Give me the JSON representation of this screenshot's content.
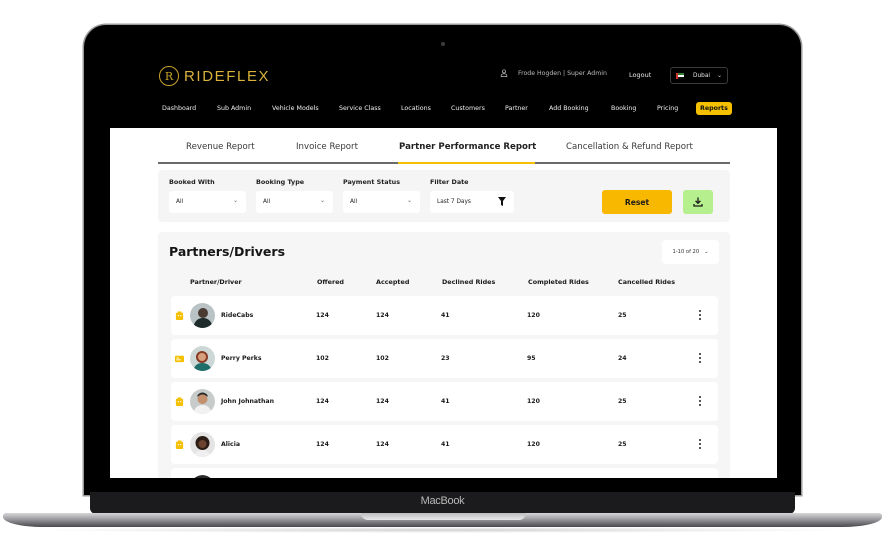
{
  "device": {
    "chin_label": "MacBook"
  },
  "header": {
    "brand": "RIDEFLEX",
    "logo_glyph": "R",
    "user_name": "Frode Hogden",
    "user_role": "| Super Admin",
    "logout_label": "Logout",
    "city": "Dubai",
    "city_flag": "uae-flag",
    "accent_color": "#f5c000"
  },
  "nav": {
    "items": [
      {
        "label": "Dashboard"
      },
      {
        "label": "Sub Admin"
      },
      {
        "label": "Vehicle Models"
      },
      {
        "label": "Service Class"
      },
      {
        "label": "Locations"
      },
      {
        "label": "Customers"
      },
      {
        "label": "Partner"
      },
      {
        "label": "Add Booking"
      },
      {
        "label": "Booking"
      },
      {
        "label": "Pricing"
      },
      {
        "label": "Reports",
        "active": true
      }
    ]
  },
  "tabs": [
    {
      "label": "Revenue Report"
    },
    {
      "label": "Invoice Report"
    },
    {
      "label": "Partner Performance Report",
      "active": true
    },
    {
      "label": "Cancellation & Refund Report"
    }
  ],
  "filters": {
    "booked_with": {
      "label": "Booked With",
      "value": "All"
    },
    "booking_type": {
      "label": "Booking Type",
      "value": "All"
    },
    "payment_status": {
      "label": "Payment Status",
      "value": "All"
    },
    "filter_date": {
      "label": "Filter Date",
      "value": "Last 7 Days"
    },
    "reset_label": "Reset",
    "download_icon": "download-icon",
    "reset_color": "#f9b800",
    "download_color": "#b6ef8d"
  },
  "table": {
    "title": "Partners/Drivers",
    "pager": "1-10 of 20",
    "columns": [
      "Partner/Driver",
      "Offered",
      "Accepted",
      "Declined Rides",
      "Completed Rides",
      "Cancelled Rides"
    ],
    "rows": [
      {
        "type_icon": "company-building-icon",
        "name": "RideCabs",
        "offered": "124",
        "accepted": "124",
        "declined": "41",
        "completed": "120",
        "cancelled": "25"
      },
      {
        "type_icon": "driver-id-card-icon",
        "name": "Perry Perks",
        "offered": "102",
        "accepted": "102",
        "declined": "23",
        "completed": "95",
        "cancelled": "24"
      },
      {
        "type_icon": "company-building-icon",
        "name": "John Johnathan",
        "offered": "124",
        "accepted": "124",
        "declined": "41",
        "completed": "120",
        "cancelled": "25"
      },
      {
        "type_icon": "company-building-icon",
        "name": "Alicia",
        "offered": "124",
        "accepted": "124",
        "declined": "41",
        "completed": "120",
        "cancelled": "25"
      }
    ]
  }
}
